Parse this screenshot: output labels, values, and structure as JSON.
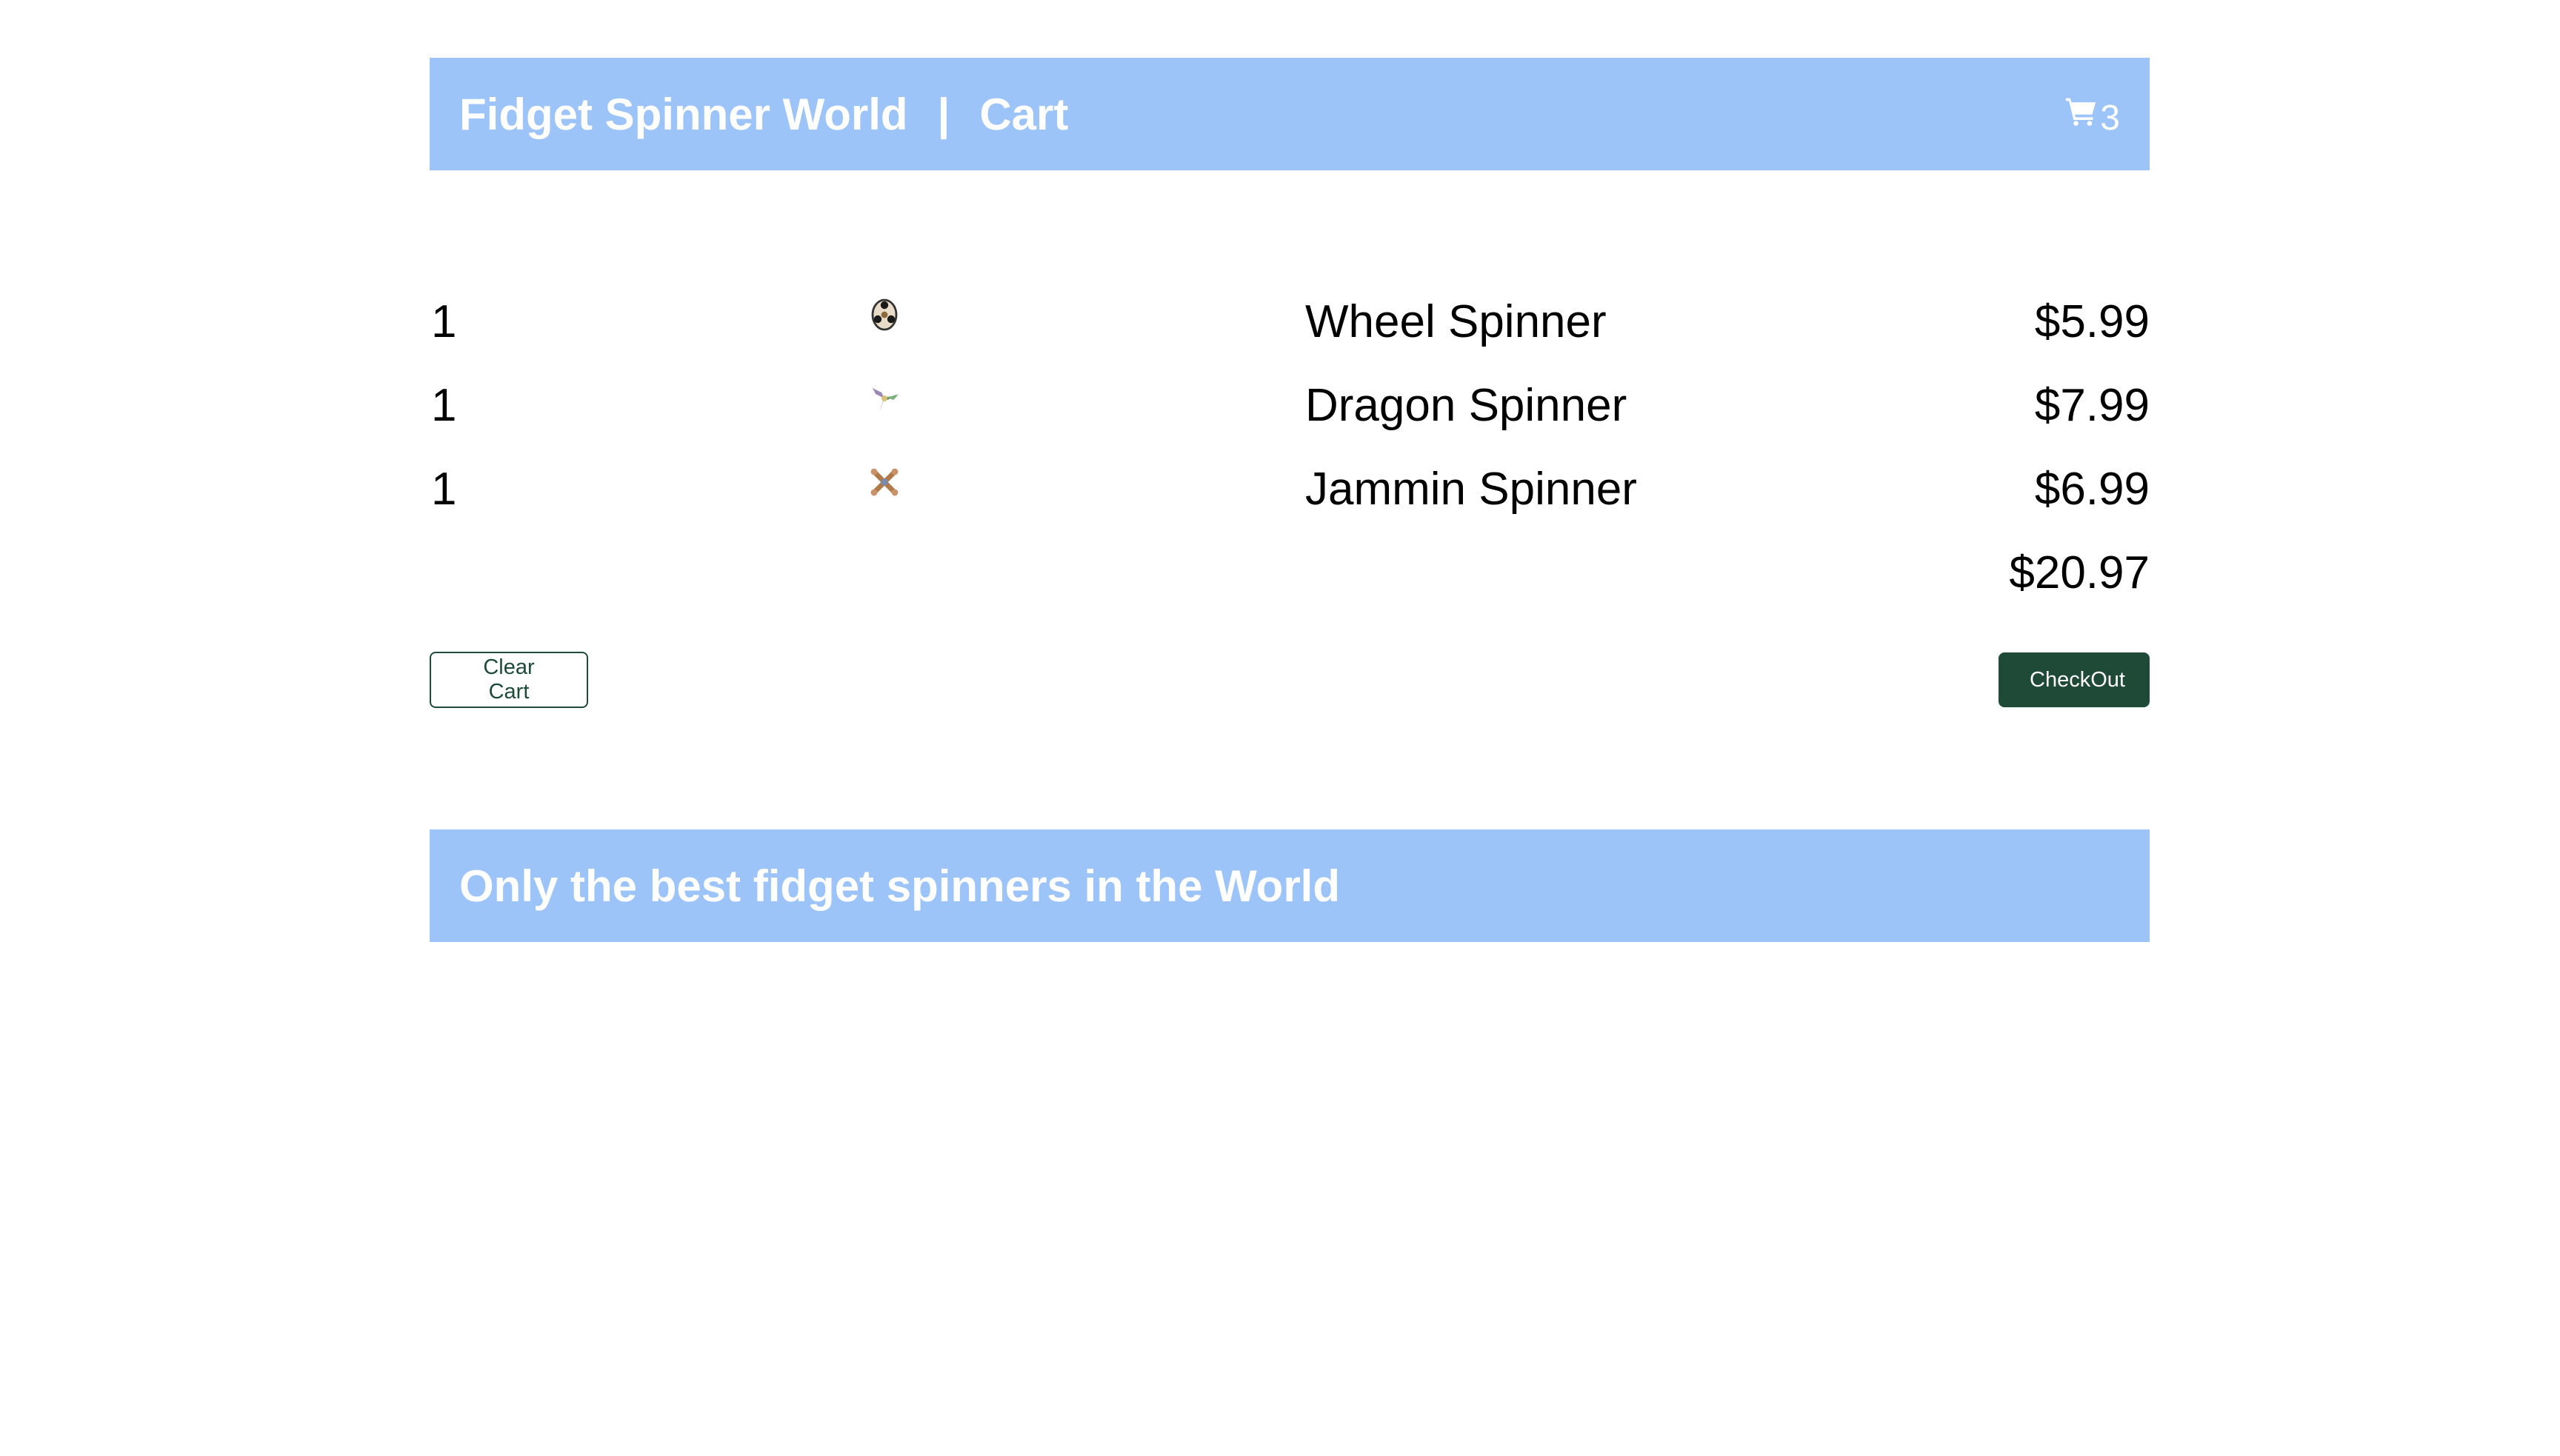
{
  "header": {
    "store_name": "Fidget Spinner World",
    "separator": "|",
    "page_name": "Cart",
    "cart_icon": "shopping-cart-icon",
    "cart_count": "3"
  },
  "cart": {
    "items": [
      {
        "quantity": "1",
        "image_icon": "wheel-spinner-image",
        "name": "Wheel Spinner",
        "price": "$5.99"
      },
      {
        "quantity": "1",
        "image_icon": "dragon-spinner-image",
        "name": "Dragon Spinner",
        "price": "$7.99"
      },
      {
        "quantity": "1",
        "image_icon": "jammin-spinner-image",
        "name": "Jammin Spinner",
        "price": "$6.99"
      }
    ],
    "total": "$20.97"
  },
  "actions": {
    "clear_label": "Clear Cart",
    "checkout_label": "CheckOut"
  },
  "footer": {
    "tagline": "Only the best fidget spinners in the World"
  },
  "colors": {
    "banner": "#9dc4f8",
    "primary_button": "#1f4a38",
    "banner_text": "#ffffff"
  }
}
